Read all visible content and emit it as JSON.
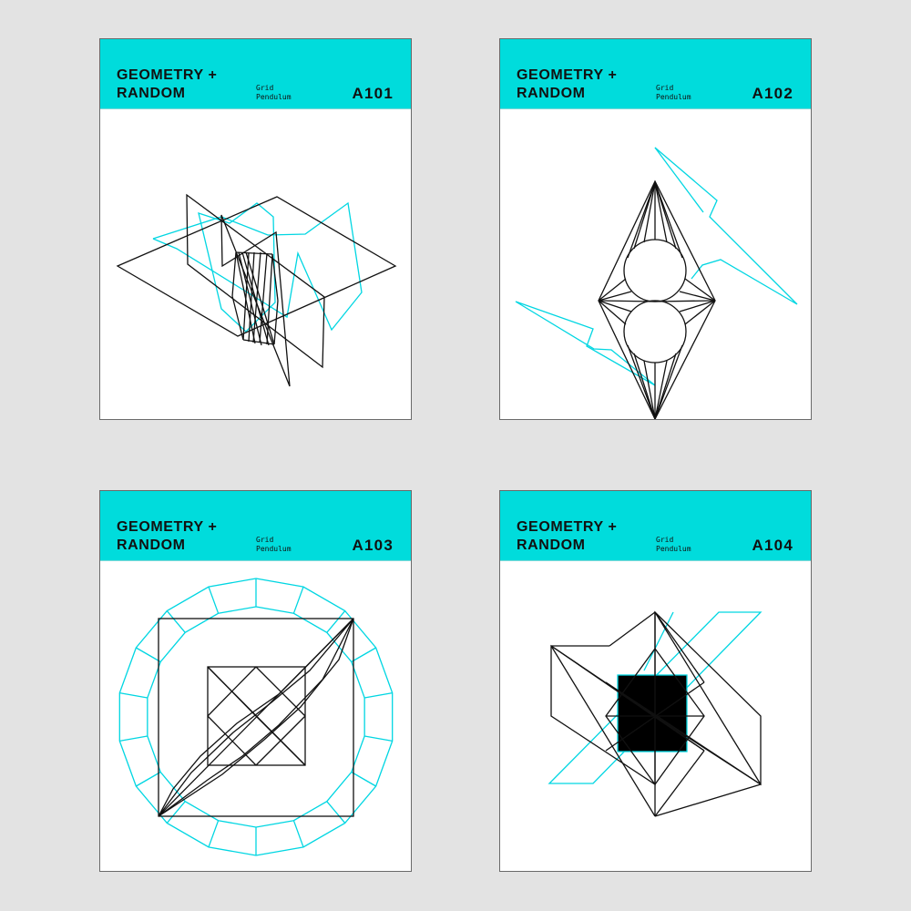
{
  "cards": [
    {
      "title_line1": "GEOMETRY +",
      "title_line2": "RANDOM",
      "sub_line1": "Grid",
      "sub_line2": "Pendulum",
      "code": "A101"
    },
    {
      "title_line1": "GEOMETRY +",
      "title_line2": "RANDOM",
      "sub_line1": "Grid",
      "sub_line2": "Pendulum",
      "code": "A102"
    },
    {
      "title_line1": "GEOMETRY +",
      "title_line2": "RANDOM",
      "sub_line1": "Grid",
      "sub_line2": "Pendulum",
      "code": "A103"
    },
    {
      "title_line1": "GEOMETRY +",
      "title_line2": "RANDOM",
      "sub_line1": "Grid",
      "sub_line2": "Pendulum",
      "code": "A104"
    }
  ],
  "colors": {
    "background": "#e3e3e3",
    "header": "#00dcdc",
    "line_black": "#111111",
    "line_cyan": "#00d6e2",
    "grid_dot": "#c9c9c9"
  }
}
